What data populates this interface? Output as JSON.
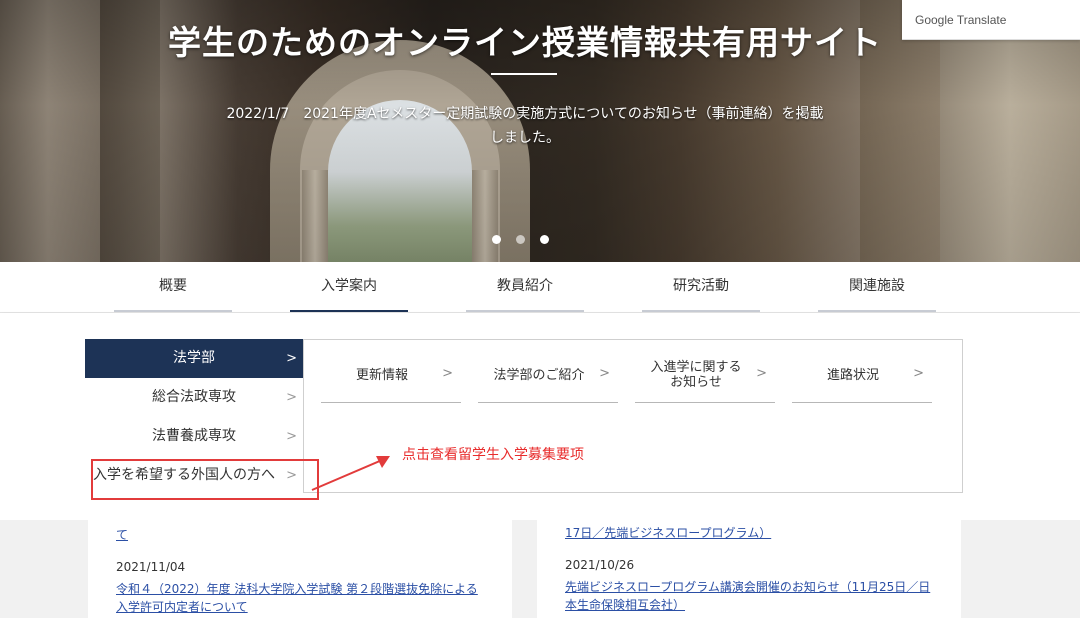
{
  "hero": {
    "title": "学生のためのオンライン授業情報共有用サイト",
    "news_line1": "2022/1/7　2021年度Aセメスター定期試験の実施方式についてのお知らせ（事前連絡）を掲載",
    "news_line2": "しました。"
  },
  "google_translate": {
    "label": "Google Translate"
  },
  "nav": {
    "items": [
      "概要",
      "入学案内",
      "教員紹介",
      "研究活動",
      "関連施設"
    ],
    "active": "入学案内"
  },
  "sidebar": {
    "items": [
      {
        "label": "法学部"
      },
      {
        "label": "総合法政専攻"
      },
      {
        "label": "法曹養成専攻"
      },
      {
        "label": "入学を希望する外国人の方へ"
      }
    ],
    "chevron": ">"
  },
  "submenu": {
    "items": [
      {
        "label": "更新情報"
      },
      {
        "label": "法学部のご紹介"
      },
      {
        "label_line1": "入進学に関する",
        "label_line2": "お知らせ"
      },
      {
        "label": "進路状況"
      }
    ]
  },
  "annotation": {
    "text": "点击查看留学生入学募集要项",
    "color": "#e82c2c"
  },
  "news": {
    "left": {
      "partial": "て",
      "date": "2021/11/04",
      "link_line1": "令和４（2022）年度 法科大学院入学試験 第２段階選抜免除による",
      "link_line2": "入学許可内定者について"
    },
    "right": {
      "partial": "17日／先端ビジネスロープログラム）",
      "date": "2021/10/26",
      "link_line1": "先端ビジネスロープログラム講演会開催のお知らせ（11月25日／日",
      "link_line2": "本生命保険相互会社）"
    }
  },
  "colors": {
    "nav_active": "#1d3356",
    "link": "#2b4fa5",
    "highlight_border": "#e23b3b"
  }
}
